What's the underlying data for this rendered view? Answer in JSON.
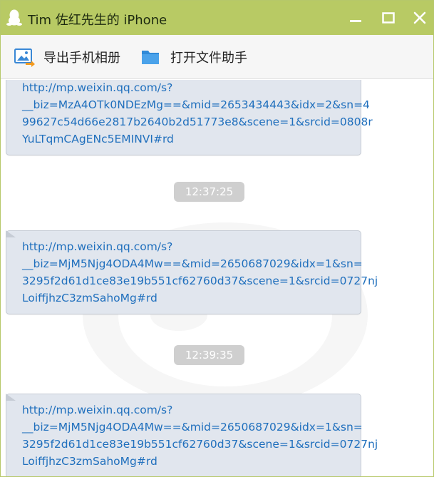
{
  "window": {
    "title": "Tim 佐红先生的 iPhone",
    "colors": {
      "titlebar": "#b8ca64",
      "link": "#1f6fbd",
      "bubble": "#e1e6ee",
      "time_badge": "#cfcfcf"
    }
  },
  "toolbar": {
    "export_album": "导出手机相册",
    "open_file_helper": "打开文件助手"
  },
  "messages": [
    {
      "type": "link",
      "lines": [
        "http://mp.weixin.qq.com/s?",
        "__biz=MzA4OTk0NDEzMg==&mid=2653434443&idx=2&sn=4",
        "99627c54d66e2817b2640b2d51773e8&scene=1&srcid=0808r",
        "YuLTqmCAgENc5EMINVI#rd"
      ]
    },
    {
      "type": "time",
      "text": "12:37:25"
    },
    {
      "type": "link",
      "lines": [
        "http://mp.weixin.qq.com/s?",
        "__biz=MjM5Njg4ODA4Mw==&mid=2650687029&idx=1&sn=",
        "3295f2d61d1ce83e19b551cf62760d37&scene=1&srcid=0727nj",
        "LoiffjhzC3zmSahoMg#rd"
      ]
    },
    {
      "type": "time",
      "text": "12:39:35"
    },
    {
      "type": "link",
      "lines": [
        "http://mp.weixin.qq.com/s?",
        "__biz=MjM5Njg4ODA4Mw==&mid=2650687029&idx=1&sn=",
        "3295f2d61d1ce83e19b551cf62760d37&scene=1&srcid=0727nj",
        "LoiffjhzC3zmSahoMg#rd"
      ]
    }
  ]
}
